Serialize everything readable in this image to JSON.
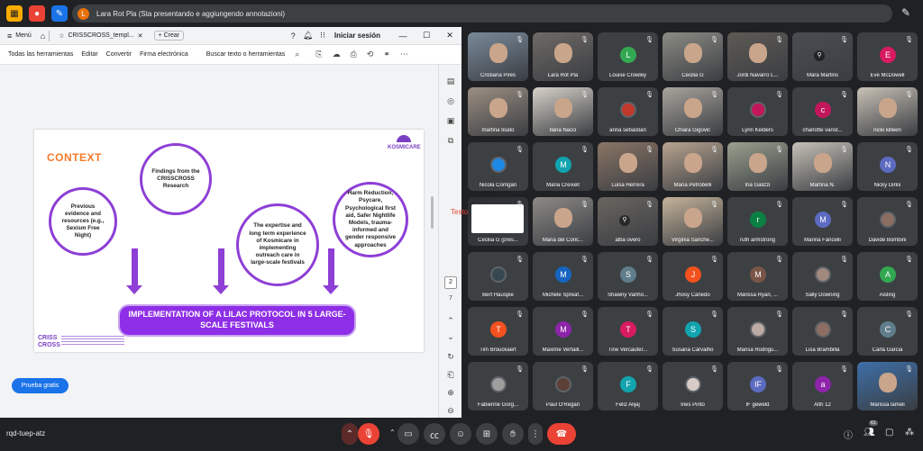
{
  "topbar": {
    "presenter_initial": "L",
    "presenting_text": "Lara Rot Pla (Sta presentando e aggiungendo annotazioni)"
  },
  "pdf": {
    "menu_label": "Menú",
    "tab_title": "CRISSCROSS_templ...",
    "new_label": "Crear",
    "signin": "Iniciar sesión",
    "toolbar": [
      "Todas las herramientas",
      "Editar",
      "Convertir",
      "Firma electrónica"
    ],
    "search_placeholder": "Buscar texto o herramientas",
    "page_current": "2",
    "page_total": "7",
    "trial_button": "Prueba gratis"
  },
  "slide": {
    "heading": "CONTEXT",
    "logo_text": "KOSMICARE",
    "circles": [
      "Previous evidence and resources (e.g., Sexism Free Night)",
      "Findings from the CRISSCROSS Research",
      "The expertise and long term experience of Kosmicare in implementing outreach care in large-scale festivals",
      "Harm Reduction, Psycare, Psychological first aid, Safer Nightlife Models, trauma-informed and gender responsive approaches"
    ],
    "banner": "IMPLEMENTATION OF A LILAC PROTOCOL IN 5 LARGE-SCALE FESTIVALS",
    "footer_logo_top": "CRISS",
    "footer_logo_bottom": "CROSS"
  },
  "annotation_text": "Testo",
  "participants": [
    {
      "name": "Cristiana Pires",
      "type": "video",
      "bg": "#7a8a9a"
    },
    {
      "name": "Lara Rot Pla",
      "type": "video",
      "bg": "#6f6a66"
    },
    {
      "name": "Louise Crowley",
      "type": "avatar",
      "initial": "L",
      "color": "#33a852"
    },
    {
      "name": "Cecilia G",
      "type": "video",
      "bg": "#8c8c84"
    },
    {
      "name": "Jordi Navarro L...",
      "type": "video",
      "bg": "#5e5a55"
    },
    {
      "name": "Mara Martins",
      "type": "pinned",
      "bg": "#4a4d52"
    },
    {
      "name": "Eve McDowell",
      "type": "avatar",
      "initial": "E",
      "color": "#d81b60"
    },
    {
      "name": "martina tisato",
      "type": "video",
      "bg": "#9c8f83"
    },
    {
      "name": "Ilaria Nacci",
      "type": "video",
      "bg": "#d7d2c9"
    },
    {
      "name": "anna sebastian",
      "type": "photo",
      "color": "#c0392b"
    },
    {
      "name": "Chiara Gigovic",
      "type": "video",
      "bg": "#a8a49c"
    },
    {
      "name": "Lynn Kelders",
      "type": "photo",
      "color": "#c2185b"
    },
    {
      "name": "charlotte vanst...",
      "type": "avatar",
      "initial": "c",
      "color": "#c2185b"
    },
    {
      "name": "nicki killeen",
      "type": "video",
      "bg": "#c8c1b6"
    },
    {
      "name": "Nicola Corrigan",
      "type": "photo",
      "color": "#1e88e5"
    },
    {
      "name": "Maria Creixell",
      "type": "avatar",
      "initial": "M",
      "color": "#12a4af"
    },
    {
      "name": "Luisa Herrera",
      "type": "video",
      "bg": "#8a7565"
    },
    {
      "name": "Maria Petrobelli",
      "type": "video",
      "bg": "#b7a48f"
    },
    {
      "name": "Ina Galizzi",
      "type": "video",
      "bg": "#9aa08e"
    },
    {
      "name": "Martina N.",
      "type": "video",
      "bg": "#c7c2b8"
    },
    {
      "name": "Nicky Dirkx",
      "type": "avatar",
      "initial": "N",
      "color": "#5c6bc0"
    },
    {
      "name": "Cecilia G (pres...",
      "type": "screen",
      "bg": "#2d2f33"
    },
    {
      "name": "Maria del Conc...",
      "type": "video",
      "bg": "#8d8a86"
    },
    {
      "name": "alba overo",
      "type": "pinned",
      "bg": "#6a6560"
    },
    {
      "name": "Virginia Sanche...",
      "type": "video",
      "bg": "#c5b39a"
    },
    {
      "name": "ruth armstrong",
      "type": "avatar",
      "initial": "r",
      "color": "#0b8043"
    },
    {
      "name": "Marina Fancelli",
      "type": "avatar",
      "initial": "M",
      "color": "#5c6bc0"
    },
    {
      "name": "Davide Bombini",
      "type": "photo",
      "color": "#8d6e63"
    },
    {
      "name": "Bert Hauspie",
      "type": "photo",
      "color": "#37474f"
    },
    {
      "name": "Michele Spreaf...",
      "type": "avatar",
      "initial": "M",
      "color": "#1565c0"
    },
    {
      "name": "Shawny Vanho...",
      "type": "avatar",
      "initial": "S",
      "color": "#607d8b"
    },
    {
      "name": "Jhosy Canedo",
      "type": "avatar",
      "initial": "J",
      "color": "#f4511e"
    },
    {
      "name": "Marissa Ryan, ...",
      "type": "avatar",
      "initial": "M",
      "color": "#795548"
    },
    {
      "name": "Sally Downing",
      "type": "photo",
      "color": "#a1887f"
    },
    {
      "name": "Aisling",
      "type": "avatar",
      "initial": "A",
      "color": "#33a852"
    },
    {
      "name": "Tim Brouckaert",
      "type": "avatar",
      "initial": "T",
      "color": "#f4511e"
    },
    {
      "name": "Maxime Verfaill...",
      "type": "avatar",
      "initial": "M",
      "color": "#8e24aa"
    },
    {
      "name": "Tine Vercauter...",
      "type": "avatar",
      "initial": "T",
      "color": "#d81b60"
    },
    {
      "name": "Susana Carvalho",
      "type": "avatar",
      "initial": "S",
      "color": "#12a4af"
    },
    {
      "name": "Marisa Rodrigu...",
      "type": "photo",
      "color": "#bcaaa4"
    },
    {
      "name": "Lisa Brambilla",
      "type": "photo",
      "color": "#8d6e63"
    },
    {
      "name": "Carla Garcia",
      "type": "avatar",
      "initial": "C",
      "color": "#607d8b"
    },
    {
      "name": "Fabienne Gorg...",
      "type": "photo",
      "color": "#9e9e9e"
    },
    {
      "name": "Paul O'Regan",
      "type": "photo",
      "color": "#5d4037"
    },
    {
      "name": "Feliz Alijaj",
      "type": "avatar",
      "initial": "F",
      "color": "#12a4af"
    },
    {
      "name": "Ines Pinto",
      "type": "photo",
      "color": "#d7ccc8"
    },
    {
      "name": "IF geweld",
      "type": "avatar",
      "initial": "IF",
      "color": "#5c6bc0"
    },
    {
      "name": "Altri 12",
      "type": "others",
      "initial": "a",
      "color": "#8e24aa"
    },
    {
      "name": "Marissa lameli",
      "type": "video",
      "bg": "#3e6fa8"
    }
  ],
  "bottom": {
    "meeting_code": "rqd-tuep-atz",
    "people_count": "61"
  },
  "colors": {
    "accent_purple": "#8e2ee6",
    "context_orange": "#f47a2a",
    "hangup_red": "#ea4335"
  }
}
